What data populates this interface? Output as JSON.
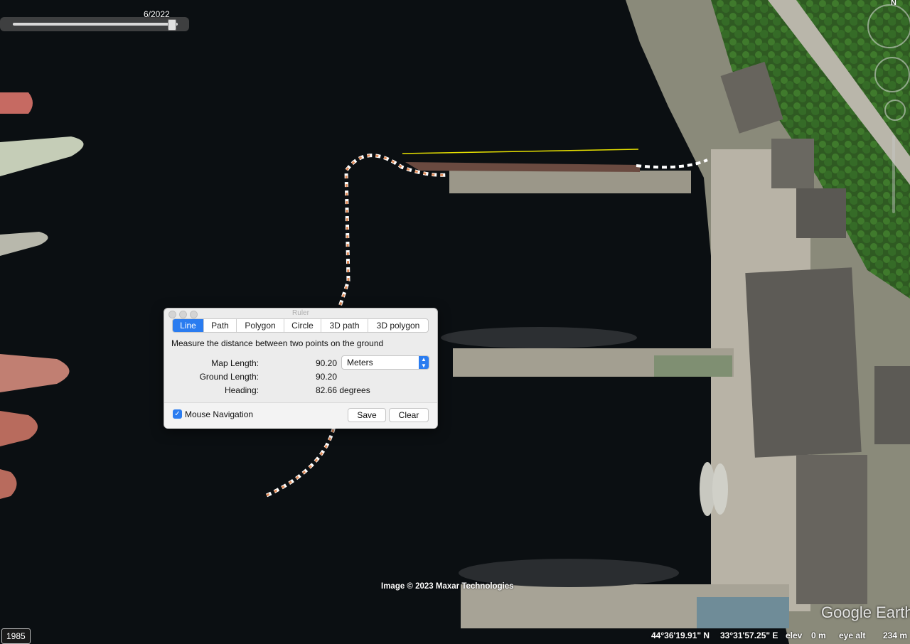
{
  "timeline": {
    "date_label": "6/2022",
    "position": 0.96
  },
  "nav": {
    "north_label": "N"
  },
  "ruler": {
    "title": "Ruler",
    "tabs": [
      "Line",
      "Path",
      "Polygon",
      "Circle",
      "3D path",
      "3D polygon"
    ],
    "active_tab": "Line",
    "description": "Measure the distance between two points on the ground",
    "map_length_label": "Map Length:",
    "map_length_value": "90.20",
    "units_value": "Meters",
    "ground_length_label": "Ground Length:",
    "ground_length_value": "90.20",
    "heading_label": "Heading:",
    "heading_value": "82.66 degrees",
    "mouse_nav_label": "Mouse Navigation",
    "mouse_nav_checked": true,
    "save_label": "Save",
    "clear_label": "Clear"
  },
  "map": {
    "attribution": "Image © 2023 Maxar Technologies",
    "brand": "Google Earth",
    "year_badge": "1985"
  },
  "status": {
    "lat": "44°36'19.91\" N",
    "lon": "33°31'57.25\" E",
    "elev_label": "elev",
    "elev_value": "0 m",
    "eye_alt_label": "eye alt",
    "eye_alt_value": "234 m"
  },
  "colors": {
    "water": "#0b0f12",
    "accent": "#2a7cf0",
    "measure_line": "#e8e200"
  }
}
